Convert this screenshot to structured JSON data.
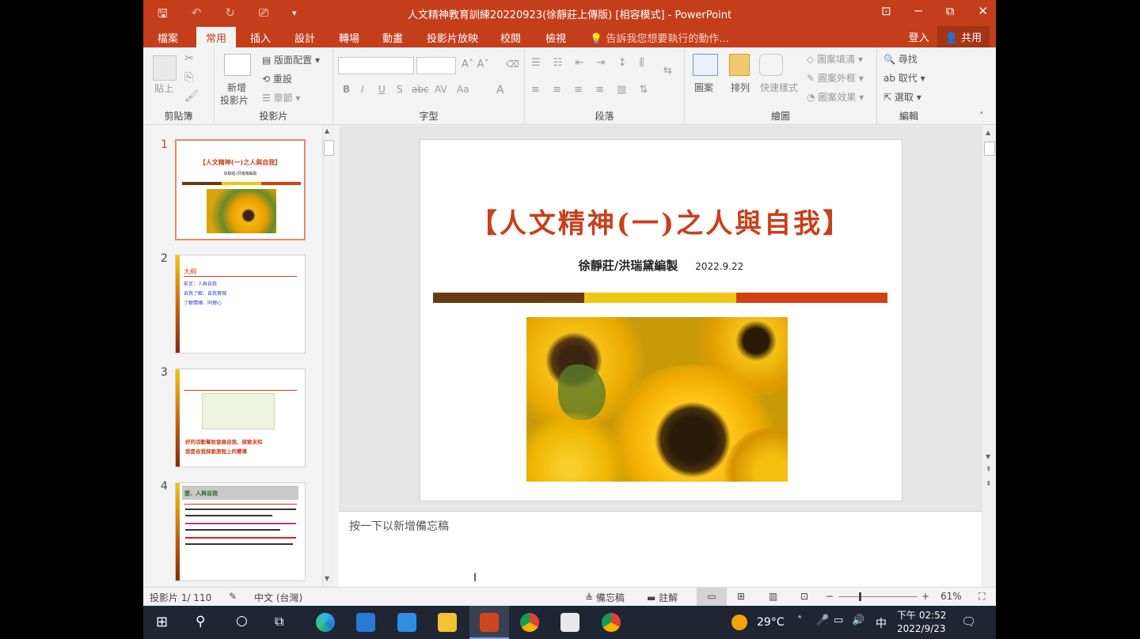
{
  "window": {
    "title": "人文精神教育訓練20220923(徐靜莊上傳版) [相容模式] - PowerPoint",
    "minimize": "─",
    "restore": "⧉",
    "close": "✕",
    "ribbon_display": "⊡"
  },
  "qat": {
    "save": "🖫",
    "undo": "↶",
    "redo": "↻",
    "present": "⎚",
    "more": "⚲"
  },
  "tabs": [
    "檔案",
    "常用",
    "插入",
    "設計",
    "轉場",
    "動畫",
    "投影片放映",
    "校閱",
    "檢視"
  ],
  "active_tab": "常用",
  "tell_me": "告訴我您想要執行的動作...",
  "sign_in": "登入",
  "share": "共用",
  "ribbon": {
    "clipboard": {
      "label": "剪貼簿",
      "paste": "貼上"
    },
    "slides": {
      "label": "投影片",
      "new_slide_1": "新增",
      "new_slide_2": "投影片",
      "layout": "版面配置",
      "reset": "重設",
      "section": "章節"
    },
    "font": {
      "label": "字型",
      "font_name": "",
      "font_size": "",
      "bold": "B",
      "italic": "I",
      "underline": "U",
      "strike": "S",
      "shadow": "abc",
      "spacing": "AV",
      "case": "Aa",
      "color": "A"
    },
    "paragraph": {
      "label": "段落"
    },
    "drawing": {
      "label": "繪圖",
      "shapes": "圖案",
      "arrange": "排列",
      "quick_styles": "快速樣式",
      "fill": "圖案填滿",
      "outline": "圖案外框",
      "effects": "圖案效果"
    },
    "editing": {
      "label": "編輯",
      "find": "尋找",
      "replace": "取代",
      "select": "選取"
    }
  },
  "thumbnails": [
    {
      "number": "1",
      "title": "【人文精神(一)之人與自我】",
      "subtitle": "徐靜莊/洪瑞黛編製"
    },
    {
      "number": "2",
      "heading": "大綱",
      "items": [
        "前言：人與自我",
        "自我了解、自我實現",
        "了解情緒、同理心"
      ]
    },
    {
      "number": "3",
      "caption_1": "好的活動幫助發展自我、探索未知",
      "caption_2": "我是自我探索旅程上的嚮導"
    },
    {
      "number": "4",
      "heading": "壹、人與自我"
    }
  ],
  "slide": {
    "title": "【人文精神(一)之人與自我】",
    "authors": "徐靜莊/洪瑞黛編製",
    "date": "2022.9.22",
    "bar_colors": [
      "#6b3a0e",
      "#f2c515",
      "#d4400f"
    ]
  },
  "notes_placeholder": "按一下以新增備忘稿",
  "status": {
    "slide_counter": "投影片 1/ 110",
    "language": "中文 (台灣)",
    "notes": "備忘稿",
    "comments": "註解",
    "zoom": "61%"
  },
  "taskbar": {
    "temperature": "29°C",
    "ime": "中",
    "time": "下午 02:52",
    "date": "2022/9/23"
  }
}
